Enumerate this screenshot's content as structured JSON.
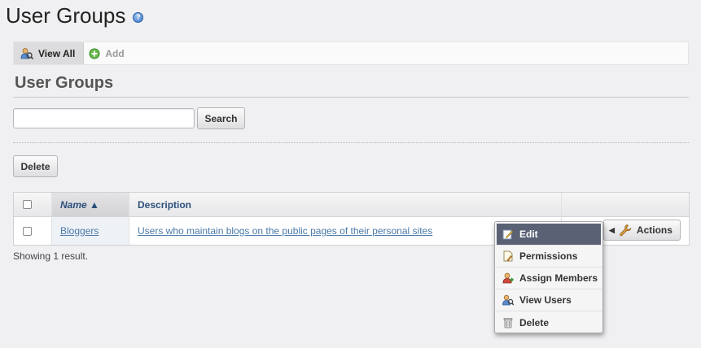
{
  "header": {
    "title": "User Groups",
    "help_icon": "help-icon"
  },
  "toolbar": {
    "view_all_label": "View All",
    "add_label": "Add"
  },
  "section": {
    "title": "User Groups"
  },
  "search": {
    "value": "",
    "placeholder": "",
    "button_label": "Search"
  },
  "bulk": {
    "delete_label": "Delete"
  },
  "table": {
    "columns": {
      "name": "Name ▲",
      "description": "Description"
    },
    "rows": [
      {
        "name": "Bloggers",
        "description": "Users who maintain blogs on the public pages of their personal sites"
      }
    ]
  },
  "actions": {
    "button_label": "Actions"
  },
  "menu": {
    "items": [
      {
        "label": "Edit",
        "icon": "edit-icon"
      },
      {
        "label": "Permissions",
        "icon": "permissions-icon"
      },
      {
        "label": "Assign Members",
        "icon": "assign-members-icon"
      },
      {
        "label": "View Users",
        "icon": "view-users-icon"
      },
      {
        "label": "Delete",
        "icon": "trash-icon"
      }
    ]
  },
  "footer": {
    "result_text": "Showing 1 result."
  },
  "colors": {
    "link": "#4a79a8",
    "header_text": "#2b4f7a",
    "menu_highlight": "#5a6174"
  }
}
